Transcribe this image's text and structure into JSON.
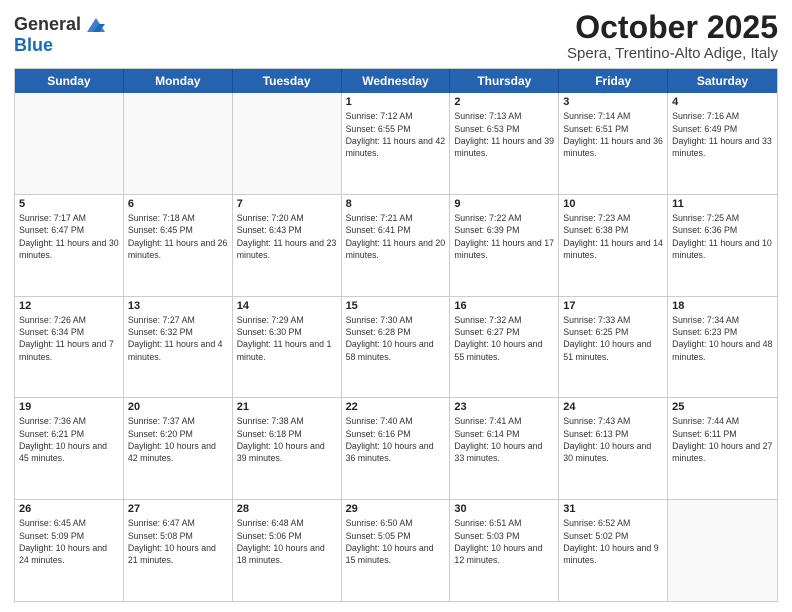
{
  "logo": {
    "general": "General",
    "blue": "Blue"
  },
  "title": "October 2025",
  "subtitle": "Spera, Trentino-Alto Adige, Italy",
  "header_days": [
    "Sunday",
    "Monday",
    "Tuesday",
    "Wednesday",
    "Thursday",
    "Friday",
    "Saturday"
  ],
  "weeks": [
    [
      {
        "day": "",
        "sunrise": "",
        "sunset": "",
        "daylight": ""
      },
      {
        "day": "",
        "sunrise": "",
        "sunset": "",
        "daylight": ""
      },
      {
        "day": "",
        "sunrise": "",
        "sunset": "",
        "daylight": ""
      },
      {
        "day": "1",
        "sunrise": "Sunrise: 7:12 AM",
        "sunset": "Sunset: 6:55 PM",
        "daylight": "Daylight: 11 hours and 42 minutes."
      },
      {
        "day": "2",
        "sunrise": "Sunrise: 7:13 AM",
        "sunset": "Sunset: 6:53 PM",
        "daylight": "Daylight: 11 hours and 39 minutes."
      },
      {
        "day": "3",
        "sunrise": "Sunrise: 7:14 AM",
        "sunset": "Sunset: 6:51 PM",
        "daylight": "Daylight: 11 hours and 36 minutes."
      },
      {
        "day": "4",
        "sunrise": "Sunrise: 7:16 AM",
        "sunset": "Sunset: 6:49 PM",
        "daylight": "Daylight: 11 hours and 33 minutes."
      }
    ],
    [
      {
        "day": "5",
        "sunrise": "Sunrise: 7:17 AM",
        "sunset": "Sunset: 6:47 PM",
        "daylight": "Daylight: 11 hours and 30 minutes."
      },
      {
        "day": "6",
        "sunrise": "Sunrise: 7:18 AM",
        "sunset": "Sunset: 6:45 PM",
        "daylight": "Daylight: 11 hours and 26 minutes."
      },
      {
        "day": "7",
        "sunrise": "Sunrise: 7:20 AM",
        "sunset": "Sunset: 6:43 PM",
        "daylight": "Daylight: 11 hours and 23 minutes."
      },
      {
        "day": "8",
        "sunrise": "Sunrise: 7:21 AM",
        "sunset": "Sunset: 6:41 PM",
        "daylight": "Daylight: 11 hours and 20 minutes."
      },
      {
        "day": "9",
        "sunrise": "Sunrise: 7:22 AM",
        "sunset": "Sunset: 6:39 PM",
        "daylight": "Daylight: 11 hours and 17 minutes."
      },
      {
        "day": "10",
        "sunrise": "Sunrise: 7:23 AM",
        "sunset": "Sunset: 6:38 PM",
        "daylight": "Daylight: 11 hours and 14 minutes."
      },
      {
        "day": "11",
        "sunrise": "Sunrise: 7:25 AM",
        "sunset": "Sunset: 6:36 PM",
        "daylight": "Daylight: 11 hours and 10 minutes."
      }
    ],
    [
      {
        "day": "12",
        "sunrise": "Sunrise: 7:26 AM",
        "sunset": "Sunset: 6:34 PM",
        "daylight": "Daylight: 11 hours and 7 minutes."
      },
      {
        "day": "13",
        "sunrise": "Sunrise: 7:27 AM",
        "sunset": "Sunset: 6:32 PM",
        "daylight": "Daylight: 11 hours and 4 minutes."
      },
      {
        "day": "14",
        "sunrise": "Sunrise: 7:29 AM",
        "sunset": "Sunset: 6:30 PM",
        "daylight": "Daylight: 11 hours and 1 minute."
      },
      {
        "day": "15",
        "sunrise": "Sunrise: 7:30 AM",
        "sunset": "Sunset: 6:28 PM",
        "daylight": "Daylight: 10 hours and 58 minutes."
      },
      {
        "day": "16",
        "sunrise": "Sunrise: 7:32 AM",
        "sunset": "Sunset: 6:27 PM",
        "daylight": "Daylight: 10 hours and 55 minutes."
      },
      {
        "day": "17",
        "sunrise": "Sunrise: 7:33 AM",
        "sunset": "Sunset: 6:25 PM",
        "daylight": "Daylight: 10 hours and 51 minutes."
      },
      {
        "day": "18",
        "sunrise": "Sunrise: 7:34 AM",
        "sunset": "Sunset: 6:23 PM",
        "daylight": "Daylight: 10 hours and 48 minutes."
      }
    ],
    [
      {
        "day": "19",
        "sunrise": "Sunrise: 7:36 AM",
        "sunset": "Sunset: 6:21 PM",
        "daylight": "Daylight: 10 hours and 45 minutes."
      },
      {
        "day": "20",
        "sunrise": "Sunrise: 7:37 AM",
        "sunset": "Sunset: 6:20 PM",
        "daylight": "Daylight: 10 hours and 42 minutes."
      },
      {
        "day": "21",
        "sunrise": "Sunrise: 7:38 AM",
        "sunset": "Sunset: 6:18 PM",
        "daylight": "Daylight: 10 hours and 39 minutes."
      },
      {
        "day": "22",
        "sunrise": "Sunrise: 7:40 AM",
        "sunset": "Sunset: 6:16 PM",
        "daylight": "Daylight: 10 hours and 36 minutes."
      },
      {
        "day": "23",
        "sunrise": "Sunrise: 7:41 AM",
        "sunset": "Sunset: 6:14 PM",
        "daylight": "Daylight: 10 hours and 33 minutes."
      },
      {
        "day": "24",
        "sunrise": "Sunrise: 7:43 AM",
        "sunset": "Sunset: 6:13 PM",
        "daylight": "Daylight: 10 hours and 30 minutes."
      },
      {
        "day": "25",
        "sunrise": "Sunrise: 7:44 AM",
        "sunset": "Sunset: 6:11 PM",
        "daylight": "Daylight: 10 hours and 27 minutes."
      }
    ],
    [
      {
        "day": "26",
        "sunrise": "Sunrise: 6:45 AM",
        "sunset": "Sunset: 5:09 PM",
        "daylight": "Daylight: 10 hours and 24 minutes."
      },
      {
        "day": "27",
        "sunrise": "Sunrise: 6:47 AM",
        "sunset": "Sunset: 5:08 PM",
        "daylight": "Daylight: 10 hours and 21 minutes."
      },
      {
        "day": "28",
        "sunrise": "Sunrise: 6:48 AM",
        "sunset": "Sunset: 5:06 PM",
        "daylight": "Daylight: 10 hours and 18 minutes."
      },
      {
        "day": "29",
        "sunrise": "Sunrise: 6:50 AM",
        "sunset": "Sunset: 5:05 PM",
        "daylight": "Daylight: 10 hours and 15 minutes."
      },
      {
        "day": "30",
        "sunrise": "Sunrise: 6:51 AM",
        "sunset": "Sunset: 5:03 PM",
        "daylight": "Daylight: 10 hours and 12 minutes."
      },
      {
        "day": "31",
        "sunrise": "Sunrise: 6:52 AM",
        "sunset": "Sunset: 5:02 PM",
        "daylight": "Daylight: 10 hours and 9 minutes."
      },
      {
        "day": "",
        "sunrise": "",
        "sunset": "",
        "daylight": ""
      }
    ]
  ]
}
